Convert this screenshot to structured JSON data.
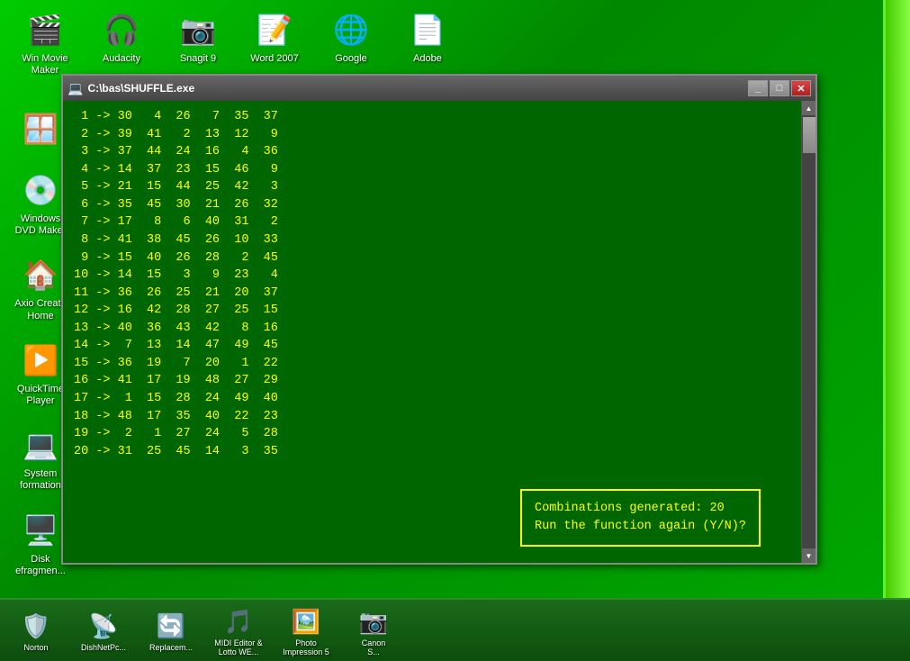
{
  "desktop": {
    "background_color": "#007700"
  },
  "top_icons": [
    {
      "id": "win-movie-maker",
      "label": "Win Movie\nMaker",
      "icon": "🎬"
    },
    {
      "id": "audacity",
      "label": "Audacity",
      "icon": "🎧"
    },
    {
      "id": "snagit-9",
      "label": "Snagit 9",
      "icon": "📷"
    },
    {
      "id": "word-2007",
      "label": "Word 2007",
      "icon": "📝"
    },
    {
      "id": "google",
      "label": "Google",
      "icon": "🌐"
    },
    {
      "id": "adobe",
      "label": "Adobe",
      "icon": "📄"
    }
  ],
  "left_icons": [
    {
      "id": "windows-logo",
      "label": "",
      "icon": "🪟"
    },
    {
      "id": "windows-dvd-maker",
      "label": "Windows\nDVD Maker",
      "icon": "💿"
    },
    {
      "id": "axio-create-home",
      "label": "Axio Create\nHome",
      "icon": "🏠"
    },
    {
      "id": "quicktime-player",
      "label": "QuickTime\nPlayer",
      "icon": "▶️"
    },
    {
      "id": "system-information",
      "label": "System\nformation",
      "icon": "💻"
    },
    {
      "id": "disk-defragmenter",
      "label": "Disk\nefragmen...",
      "icon": "🖥️"
    }
  ],
  "taskbar_icons": [
    {
      "id": "norton",
      "label": "Norton",
      "icon": "🛡️"
    },
    {
      "id": "dishnetpc",
      "label": "DishNetPc...",
      "icon": "📡"
    },
    {
      "id": "replacem",
      "label": "Replacem...",
      "icon": "🔄"
    },
    {
      "id": "midi-editor",
      "label": "MIDI Editor &\nLotto WE...",
      "icon": "🎵"
    },
    {
      "id": "photo-impression",
      "label": "Photo\nImpression 5",
      "icon": "🖼️"
    },
    {
      "id": "canon",
      "label": "Canon\nS...",
      "icon": "📷"
    }
  ],
  "window": {
    "title": "C:\\bas\\SHUFFLE.exe",
    "title_icon": "💻",
    "minimize_label": "_",
    "maximize_label": "□",
    "close_label": "✕",
    "console_lines": [
      " 1 -> 30   4  26   7  35  37",
      " 2 -> 39  41   2  13  12   9",
      " 3 -> 37  44  24  16   4  36",
      " 4 -> 14  37  23  15  46   9",
      " 5 -> 21  15  44  25  42   3",
      " 6 -> 35  45  30  21  26  32",
      " 7 -> 17   8   6  40  31   2",
      " 8 -> 41  38  45  26  10  33",
      " 9 -> 15  40  26  28   2  45",
      "10 -> 14  15   3   9  23   4",
      "11 -> 36  26  25  21  20  37",
      "12 -> 16  42  28  27  25  15",
      "13 -> 40  36  43  42   8  16",
      "14 ->  7  13  14  47  49  45",
      "15 -> 36  19   7  20   1  22",
      "16 -> 41  17  19  48  27  29",
      "17 ->  1  15  28  24  49  40",
      "18 -> 48  17  35  40  22  23",
      "19 ->  2   1  27  24   5  28",
      "20 -> 31  25  45  14   3  35"
    ],
    "prompt_line1": "Combinations generated:  20",
    "prompt_line2": "Run the function again (Y/N)?"
  }
}
